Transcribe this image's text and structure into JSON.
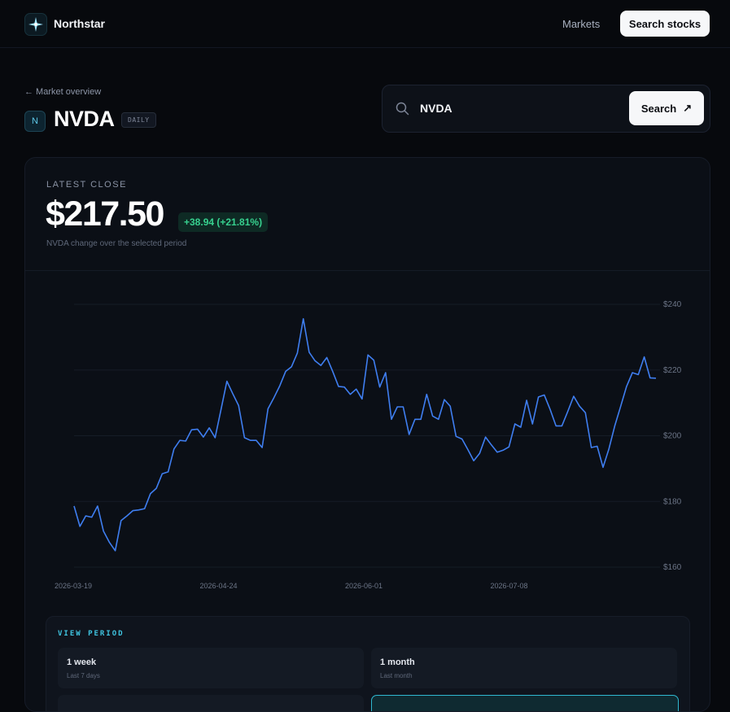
{
  "nav": {
    "brand": "Northstar",
    "link": "Markets",
    "button": "Search stocks"
  },
  "header": {
    "back_link": "← Market overview",
    "ticker_badge": "N",
    "ticker": "NVDA",
    "frequency": "DAILY"
  },
  "search": {
    "value": "NVDA",
    "button_label": "Search",
    "button_arrow": "↗"
  },
  "summary": {
    "label": "LATEST CLOSE",
    "price": "$217.50",
    "change": "+38.94 (+21.81%)",
    "subline": "NVDA change over the selected period"
  },
  "colors": {
    "line": "#3f7ef0",
    "accent": "#3fc4e0",
    "positive": "#37d18f"
  },
  "chart_data": {
    "type": "line",
    "series": [
      {
        "values": [
          178.6,
          172.4,
          175.6,
          175.2,
          178.6,
          171.0,
          167.6,
          165.0,
          174.2,
          175.6,
          177.2,
          177.4,
          177.8,
          182.4,
          184.0,
          188.4,
          189.0,
          196.0,
          198.6,
          198.4,
          201.8,
          202.0,
          199.6,
          202.4,
          199.4,
          208.0,
          216.6,
          212.8,
          209.2,
          199.4,
          198.6,
          198.6,
          196.4,
          208.2,
          211.6,
          215.2,
          219.6,
          221.0,
          225.2,
          235.6,
          225.4,
          222.8,
          221.4,
          223.8,
          219.6,
          215.0,
          214.8,
          212.6,
          214.2,
          211.2,
          224.6,
          223.0,
          214.8,
          219.2,
          205.0,
          208.8,
          208.8,
          200.4,
          205.0,
          205.0,
          212.6,
          206.0,
          205.0,
          211.0,
          209.0,
          199.8,
          199.0,
          195.8,
          192.4,
          194.6,
          199.6,
          197.2,
          195.0,
          195.6,
          196.6,
          203.6,
          202.6,
          210.8,
          203.6,
          211.8,
          212.4,
          208.0,
          203.0,
          203.0,
          207.4,
          212.0,
          209.0,
          207.0,
          196.4,
          196.8,
          190.4,
          196.0,
          203.0,
          209.0,
          215.0,
          219.2,
          218.6,
          224.0,
          217.6,
          217.5
        ]
      }
    ],
    "x_tick_labels": [
      "2026-03-19",
      "2026-04-24",
      "2026-06-01",
      "2026-07-08"
    ],
    "y_tick_labels": [
      "$240",
      "$220",
      "$200",
      "$180",
      "$160"
    ],
    "ylim": [
      160,
      240
    ],
    "grid": true
  },
  "period": {
    "title": "VIEW PERIOD",
    "options": [
      {
        "label": "1 week",
        "sub": "Last 7 days"
      },
      {
        "label": "1 month",
        "sub": "Last month"
      }
    ]
  }
}
